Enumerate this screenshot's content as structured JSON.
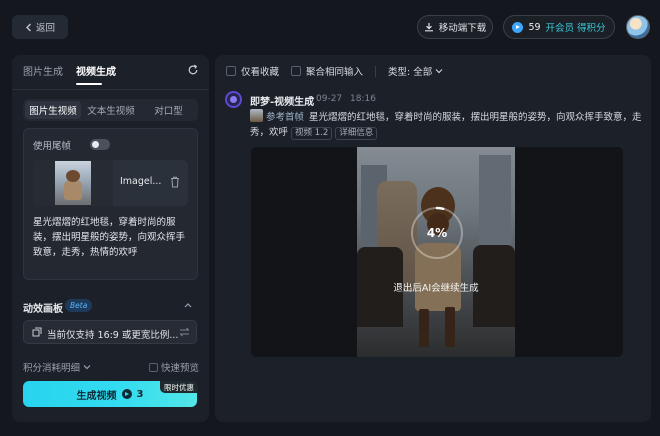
{
  "header": {
    "back_label": "返回",
    "mobile_download_label": "移动端下载",
    "credits_count": "59",
    "credits_vip_label": "开会员 得积分"
  },
  "left_panel": {
    "tabs": [
      {
        "label": "图片生成",
        "active": false
      },
      {
        "label": "视频生成",
        "active": true
      }
    ],
    "mode_tabs": [
      {
        "label": "图片生视频",
        "active": true
      },
      {
        "label": "文本生视频",
        "active": false
      },
      {
        "label": "对口型",
        "active": false
      }
    ],
    "use_end_frame_label": "使用尾帧",
    "use_end_frame_on": false,
    "upload_file_name": "Imagel...",
    "prompt": "星光熠熠的红地毯，穿着时尚的服装，摆出明星般的姿势，向观众挥手致意，走秀，热情的欢呼",
    "motion_panel_label": "动效画板",
    "beta_label": "Beta",
    "ratio_text": "当前仅支持 16:9 或更宽比例...",
    "cost_detail_label": "积分消耗明细",
    "quick_preview_label": "快速预览",
    "generate_label": "生成视频",
    "generate_cost": "3",
    "promo_label": "限时优惠"
  },
  "right_panel": {
    "filters": {
      "favorites_only_label": "仅看收藏",
      "aggregate_label": "聚合相同输入",
      "type_label": "类型: 全部"
    },
    "generation": {
      "source_title": "即梦-视频生成",
      "date": "09-27",
      "time": "18:16",
      "ref_label": "参考首帧",
      "prompt": "星光熠熠的红地毯，穿着时尚的服装，摆出明星般的姿势，向观众挥手致意，走秀，欢呼",
      "model_chip": "视频 1.2",
      "detail_chip": "详细信息",
      "progress_percent": 4,
      "progress_label": "4%",
      "progress_hint": "退出后AI会继续生成"
    }
  },
  "colors": {
    "accent": "#33dcf0",
    "credit_blue": "#3aa8ff",
    "vip_cyan": "#39c9d8",
    "panel_bg": "#1c2028",
    "page_bg": "#14171d"
  }
}
